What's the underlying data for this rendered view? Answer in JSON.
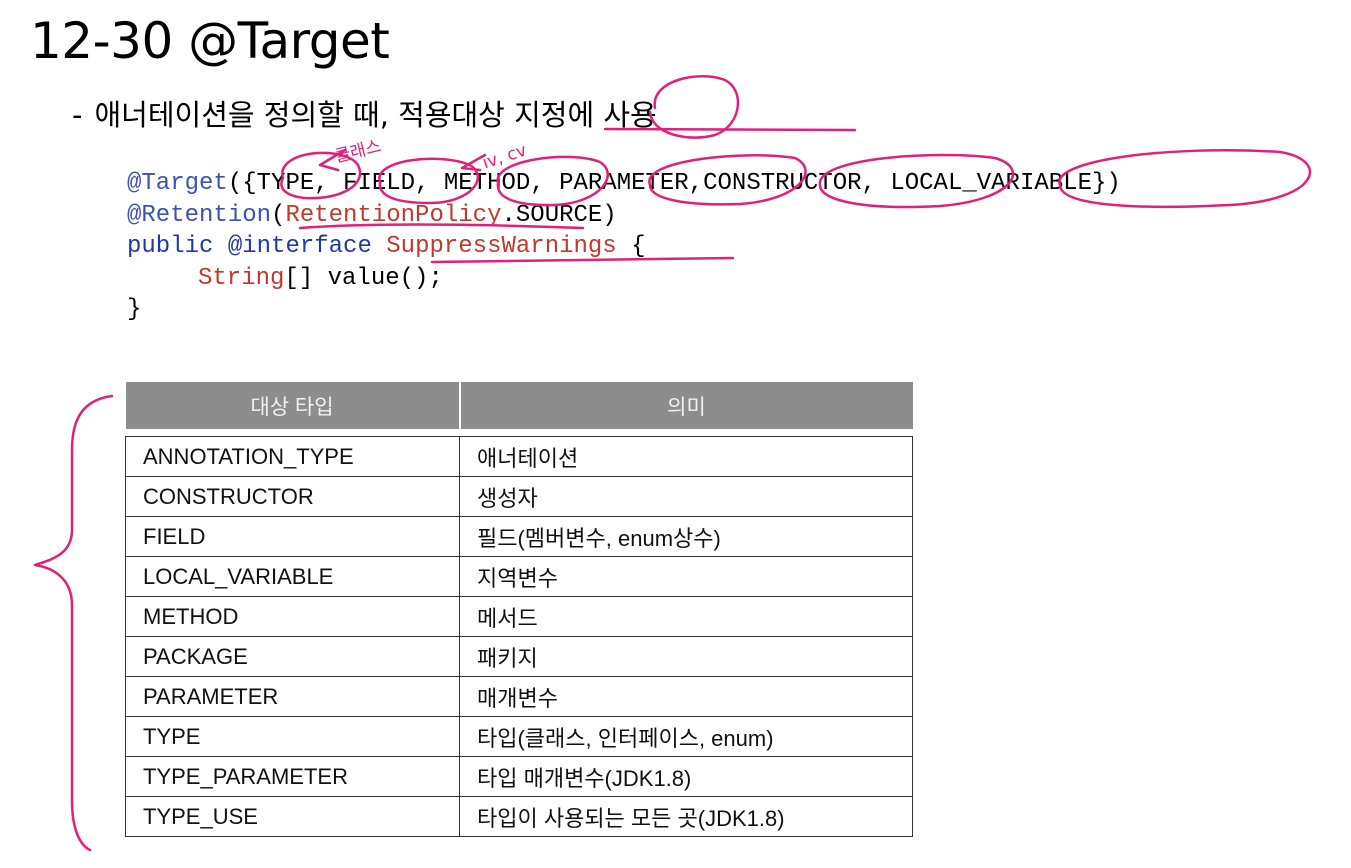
{
  "title": "12-30 @Target",
  "subtitle": {
    "dash": "-",
    "text": "애너테이션을 정의할 때, 적용대상 지정에 사용"
  },
  "code": {
    "line1_a": "@Target",
    "line1_b": "({TYPE, FIELD, METHOD, PARAMETER,CONSTRUCTOR, LOCAL_VARIABLE})",
    "line2_a": "@Retention",
    "line2_b": "(",
    "line2_c": "RetentionPolicy",
    "line2_d": ".SOURCE)",
    "line3_a": "public",
    "line3_b": "@interface",
    "line3_c": "SuppressWarnings",
    "line3_d": "{",
    "line4_a": "String",
    "line4_b": "[] value();",
    "line5": "}"
  },
  "annotations": {
    "type_note": "클래스",
    "field_note": "iv, cv"
  },
  "table": {
    "headers": [
      "대상 타입",
      "의미"
    ],
    "rows": [
      [
        "ANNOTATION_TYPE",
        "애너테이션"
      ],
      [
        "CONSTRUCTOR",
        "생성자"
      ],
      [
        "FIELD",
        "필드(멤버변수, enum상수)"
      ],
      [
        "LOCAL_VARIABLE",
        "지역변수"
      ],
      [
        "METHOD",
        "메서드"
      ],
      [
        "PACKAGE",
        "패키지"
      ],
      [
        "PARAMETER",
        "매개변수"
      ],
      [
        "TYPE",
        "타입(클래스, 인터페이스, enum)"
      ],
      [
        "TYPE_PARAMETER",
        "타입 매개변수(JDK1.8)"
      ],
      [
        "TYPE_USE",
        "타입이 사용되는 모든 곳(JDK1.8)"
      ]
    ]
  },
  "colors": {
    "ink": "#e0207a",
    "header_bg": "#8d8d8d"
  }
}
